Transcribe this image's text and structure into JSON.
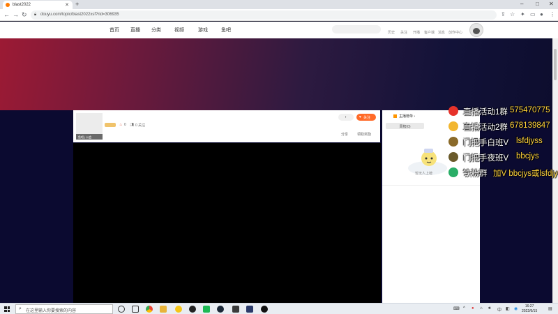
{
  "browser": {
    "tab_title": "blast2022",
    "new_tab_label": "+",
    "url": "douyu.com/topic/blast2022xsf?rid=306935",
    "window_controls": [
      "–",
      "□",
      "✕"
    ]
  },
  "site": {
    "nav": [
      "首页",
      "直播",
      "分类",
      "视频",
      "游戏",
      "鱼吧"
    ],
    "header_links": [
      "历史",
      "关注",
      "开播",
      "客户端",
      "消息",
      "创作中心"
    ]
  },
  "room": {
    "thumb_caption": "鱼吧 | 公会",
    "hot_count": "0",
    "fans_text": "0 关注",
    "follow_label": "关注",
    "share_label": "分享",
    "report_label": "领取奖励"
  },
  "side_panel": {
    "tab_rank": "主播榜单 ›",
    "tab_week": "周榜(0)",
    "mascot_caption": "暂无人上榜"
  },
  "overlay": {
    "rows": [
      {
        "label": "直播活动1群",
        "value": "575470775",
        "icon": "qq-penguin-icon",
        "color": "#e6322a"
      },
      {
        "label": "直播活动2群",
        "value": "678139847",
        "icon": "gold-coin-icon",
        "color": "#f2b630"
      },
      {
        "label": "门把手白班V",
        "value": "lsfdjyss",
        "icon": "knife-badge-icon",
        "color": "#8a6a2a"
      },
      {
        "label": "门把手夜班V",
        "value": "bbcjys",
        "icon": "knife-badge-icon",
        "color": "#6a5a2a"
      },
      {
        "label": "铁粉群",
        "value": "加V bbcjys或lsfdjyss",
        "icon": "wechat-icon",
        "color": "#2aae67"
      }
    ]
  },
  "taskbar": {
    "search_placeholder": "在这里输入你要搜索的内容",
    "time": "16:27",
    "date": "2022/6/15"
  }
}
